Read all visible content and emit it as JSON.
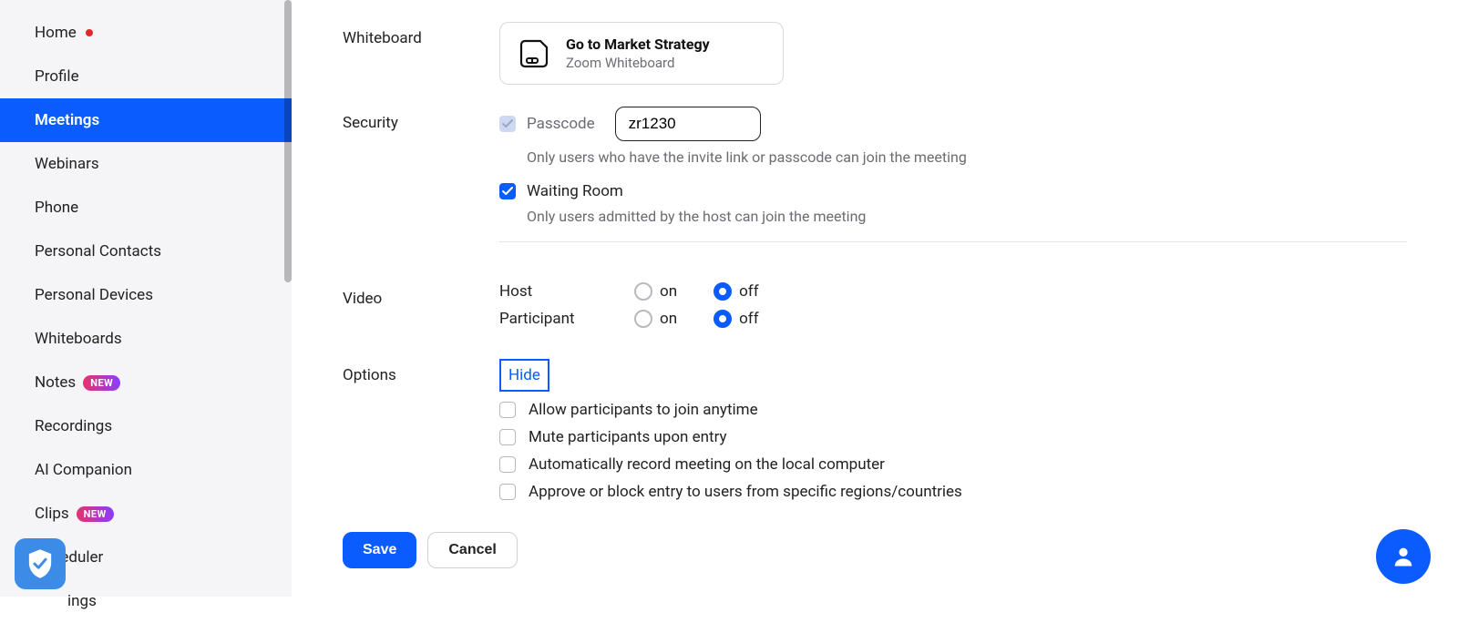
{
  "sidebar": {
    "items": [
      {
        "label": "Home",
        "dot": true
      },
      {
        "label": "Profile"
      },
      {
        "label": "Meetings",
        "active": true
      },
      {
        "label": "Webinars"
      },
      {
        "label": "Phone"
      },
      {
        "label": "Personal Contacts"
      },
      {
        "label": "Personal Devices"
      },
      {
        "label": "Whiteboards"
      },
      {
        "label": "Notes",
        "badge": "NEW"
      },
      {
        "label": "Recordings"
      },
      {
        "label": "AI Companion"
      },
      {
        "label": "Clips",
        "badge": "NEW"
      },
      {
        "label": "Scheduler"
      },
      {
        "label": "ings"
      }
    ]
  },
  "form": {
    "whiteboard": {
      "label": "Whiteboard",
      "card_title": "Go to Market Strategy",
      "card_sub": "Zoom Whiteboard"
    },
    "security": {
      "label": "Security",
      "passcode_label": "Passcode",
      "passcode_value": "zr1230",
      "passcode_help": "Only users who have the invite link or passcode can join the meeting",
      "waiting_room_label": "Waiting Room",
      "waiting_room_help": "Only users admitted by the host can join the meeting"
    },
    "video": {
      "label": "Video",
      "host_label": "Host",
      "participant_label": "Participant",
      "on_label": "on",
      "off_label": "off"
    },
    "options": {
      "label": "Options",
      "hide_label": "Hide",
      "items": [
        "Allow participants to join anytime",
        "Mute participants upon entry",
        "Automatically record meeting on the local computer",
        "Approve or block entry to users from specific regions/countries"
      ]
    },
    "save_label": "Save",
    "cancel_label": "Cancel"
  }
}
